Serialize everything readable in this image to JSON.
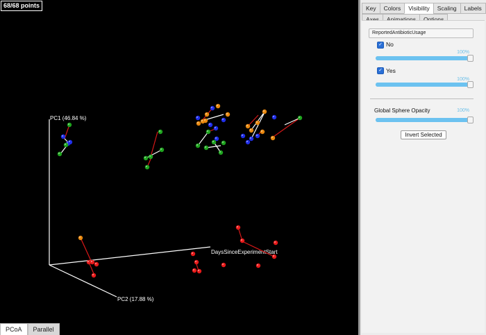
{
  "viewport": {
    "point_count": "68/68 points",
    "axis_labels": {
      "pc1": "PC1 (46.84 %)",
      "pc2": "PC2 (17.88 %)",
      "days": "DaysSinceExperimentStart"
    },
    "colors": {
      "blue": "#1f2ee8",
      "green": "#1fa51f",
      "orange": "#e8880e",
      "red": "#e81a1a",
      "line_white": "#ffffff",
      "line_red": "#d81818"
    }
  },
  "bottom_tabs": [
    "PCoA",
    "Parallel"
  ],
  "panel": {
    "tabs_row1": [
      "Key",
      "Colors",
      "Visibility",
      "Scaling",
      "Labels"
    ],
    "tabs_row2": [
      "Axes",
      "Animations",
      "Options"
    ],
    "active_tab": "Visibility",
    "category_select": "ReportedAntibioticUsage",
    "items": [
      {
        "label": "No",
        "checked": true,
        "opacity_label": "100%",
        "opacity": 1.0
      },
      {
        "label": "Yes",
        "checked": true,
        "opacity_label": "100%",
        "opacity": 1.0
      }
    ],
    "global_opacity_label": "Global Sphere Opacity",
    "global_opacity_value": "100%",
    "global_opacity": 1.0,
    "invert_button": "Invert Selected"
  }
}
